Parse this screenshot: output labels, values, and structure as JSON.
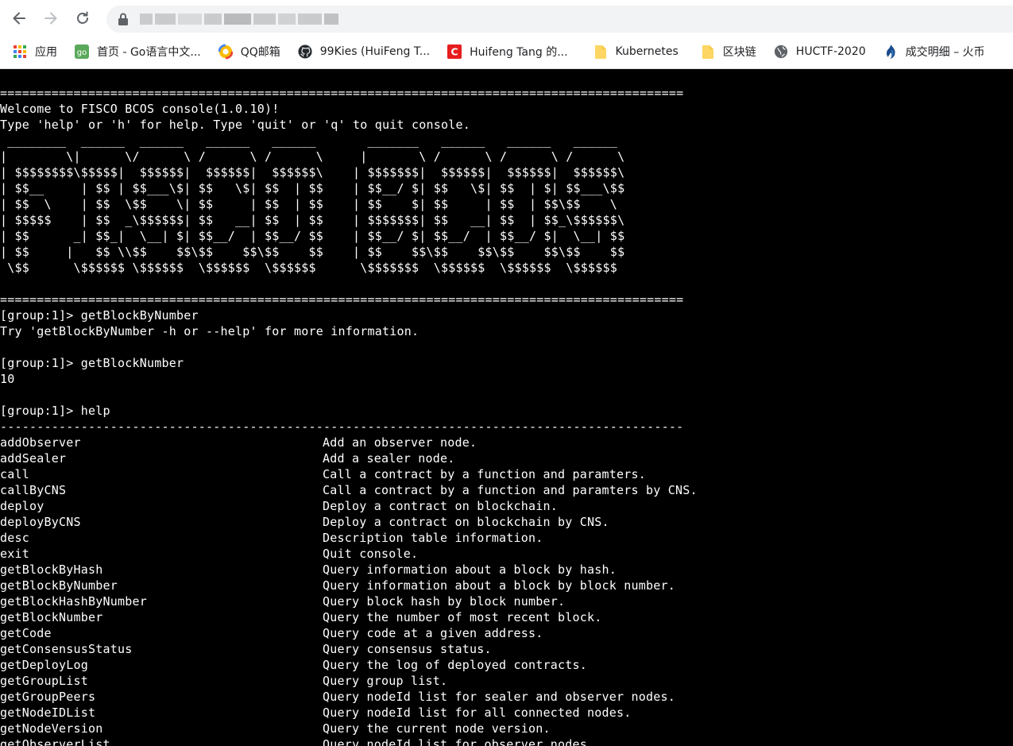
{
  "browser": {
    "back_icon": "arrow-left-icon",
    "forward_icon": "arrow-right-icon",
    "reload_icon": "reload-icon",
    "bookmarks": [
      {
        "label": "应用",
        "icon": "apps-grid-icon"
      },
      {
        "label": "首页 - Go语言中文...",
        "icon": "go-site-icon"
      },
      {
        "label": "QQ邮箱",
        "icon": "qq-mail-icon"
      },
      {
        "label": "99Kies (HuiFeng T...",
        "icon": "github-icon"
      },
      {
        "label": "Huifeng Tang 的...",
        "icon": "csdn-icon"
      },
      {
        "label": "Kubernetes",
        "icon": "folder-icon"
      },
      {
        "label": "区块链",
        "icon": "folder-icon"
      },
      {
        "label": "HUCTF-2020",
        "icon": "globe-icon"
      },
      {
        "label": "成交明细 – 火币",
        "icon": "huobi-icon"
      }
    ]
  },
  "terminal": {
    "lines": [
      "=============================================================================================",
      "Welcome to FISCO BCOS console(1.0.10)!",
      "Type 'help' or 'h' for help. Type 'quit' or 'q' to quit console.",
      " ________  ______  ______   ______   ______       _______   ______   ______   ______",
      "|        \\|      \\/      \\ /      \\ /      \\     |       \\ /      \\ /      \\ /      \\",
      "| $$$$$$$$\\$$$$$|  $$$$$$|  $$$$$$|  $$$$$$\\    | $$$$$$$|  $$$$$$|  $$$$$$|  $$$$$$\\",
      "| $$__     | $$ | $$___\\$| $$   \\$| $$  | $$    | $$__/ $| $$   \\$| $$  | $| $$___\\$$",
      "| $$  \\    | $$  \\$$    \\| $$     | $$  | $$    | $$    $| $$     | $$  | $$\\$$    \\",
      "| $$$$$    | $$  _\\$$$$$$| $$   __| $$  | $$    | $$$$$$$| $$   __| $$  | $$_\\$$$$$$\\",
      "| $$      _| $$_|  \\__| $| $$__/  | $$__/ $$    | $$__/ $| $$__/  | $$__/ $|  \\__| $$",
      "| $$     |   $$ \\\\$$    $$\\$$    $$\\$$    $$    | $$    $$\\$$    $$\\$$    $$\\$$    $$",
      " \\$$      \\$$$$$$ \\$$$$$$  \\$$$$$$  \\$$$$$$      \\$$$$$$$  \\$$$$$$  \\$$$$$$  \\$$$$$$",
      "",
      "=============================================================================================",
      "[group:1]> getBlockByNumber",
      "Try 'getBlockByNumber -h or --help' for more information.",
      "",
      "[group:1]> getBlockNumber",
      "10",
      "",
      "[group:1]> help",
      "---------------------------------------------------------------------------------------------"
    ],
    "help_rows": [
      {
        "cmd": "addObserver",
        "desc": "Add an observer node."
      },
      {
        "cmd": "addSealer",
        "desc": "Add a sealer node."
      },
      {
        "cmd": "call",
        "desc": "Call a contract by a function and paramters."
      },
      {
        "cmd": "callByCNS",
        "desc": "Call a contract by a function and paramters by CNS."
      },
      {
        "cmd": "deploy",
        "desc": "Deploy a contract on blockchain."
      },
      {
        "cmd": "deployByCNS",
        "desc": "Deploy a contract on blockchain by CNS."
      },
      {
        "cmd": "desc",
        "desc": "Description table information."
      },
      {
        "cmd": "exit",
        "desc": "Quit console."
      },
      {
        "cmd": "getBlockByHash",
        "desc": "Query information about a block by hash."
      },
      {
        "cmd": "getBlockByNumber",
        "desc": "Query information about a block by block number."
      },
      {
        "cmd": "getBlockHashByNumber",
        "desc": "Query block hash by block number."
      },
      {
        "cmd": "getBlockNumber",
        "desc": "Query the number of most recent block."
      },
      {
        "cmd": "getCode",
        "desc": "Query code at a given address."
      },
      {
        "cmd": "getConsensusStatus",
        "desc": "Query consensus status."
      },
      {
        "cmd": "getDeployLog",
        "desc": "Query the log of deployed contracts."
      },
      {
        "cmd": "getGroupList",
        "desc": "Query group list."
      },
      {
        "cmd": "getGroupPeers",
        "desc": "Query nodeId list for sealer and observer nodes."
      },
      {
        "cmd": "getNodeIDList",
        "desc": "Query nodeId list for all connected nodes."
      },
      {
        "cmd": "getNodeVersion",
        "desc": "Query the current node version."
      },
      {
        "cmd": "getObserverList",
        "desc": "Query nodeId list for observer nodes."
      }
    ]
  }
}
